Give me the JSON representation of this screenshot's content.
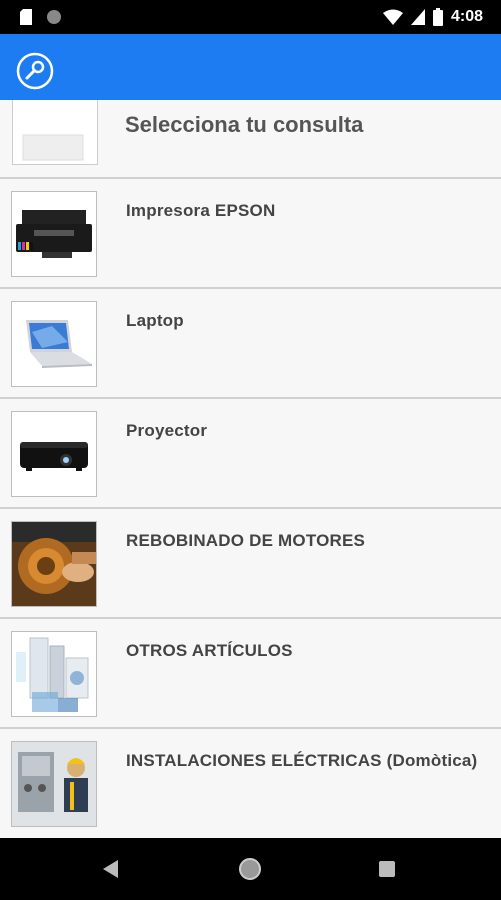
{
  "status_bar": {
    "time": "4:08",
    "icons": [
      "sd-card-icon",
      "circle-notification-icon",
      "wifi-icon",
      "signal-icon",
      "battery-icon"
    ]
  },
  "app_bar": {
    "icon": "wrench-search-icon",
    "color": "#1e7cf2"
  },
  "page": {
    "title": "Selecciona tu consulta"
  },
  "items": [
    {
      "label": "Impresora EPSON",
      "thumb": "printer-image"
    },
    {
      "label": "Laptop",
      "thumb": "laptop-image"
    },
    {
      "label": "Proyector",
      "thumb": "projector-image"
    },
    {
      "label": "REBOBINADO DE MOTORES",
      "thumb": "motor-rewinding-image"
    },
    {
      "label": "OTROS ARTÍCULOS",
      "thumb": "appliances-image"
    },
    {
      "label": "INSTALACIONES ELÉCTRICAS (Domòtica)",
      "thumb": "electrical-installation-image"
    }
  ],
  "nav_bar": {
    "icons": [
      "back-icon",
      "home-icon",
      "recents-icon"
    ]
  }
}
